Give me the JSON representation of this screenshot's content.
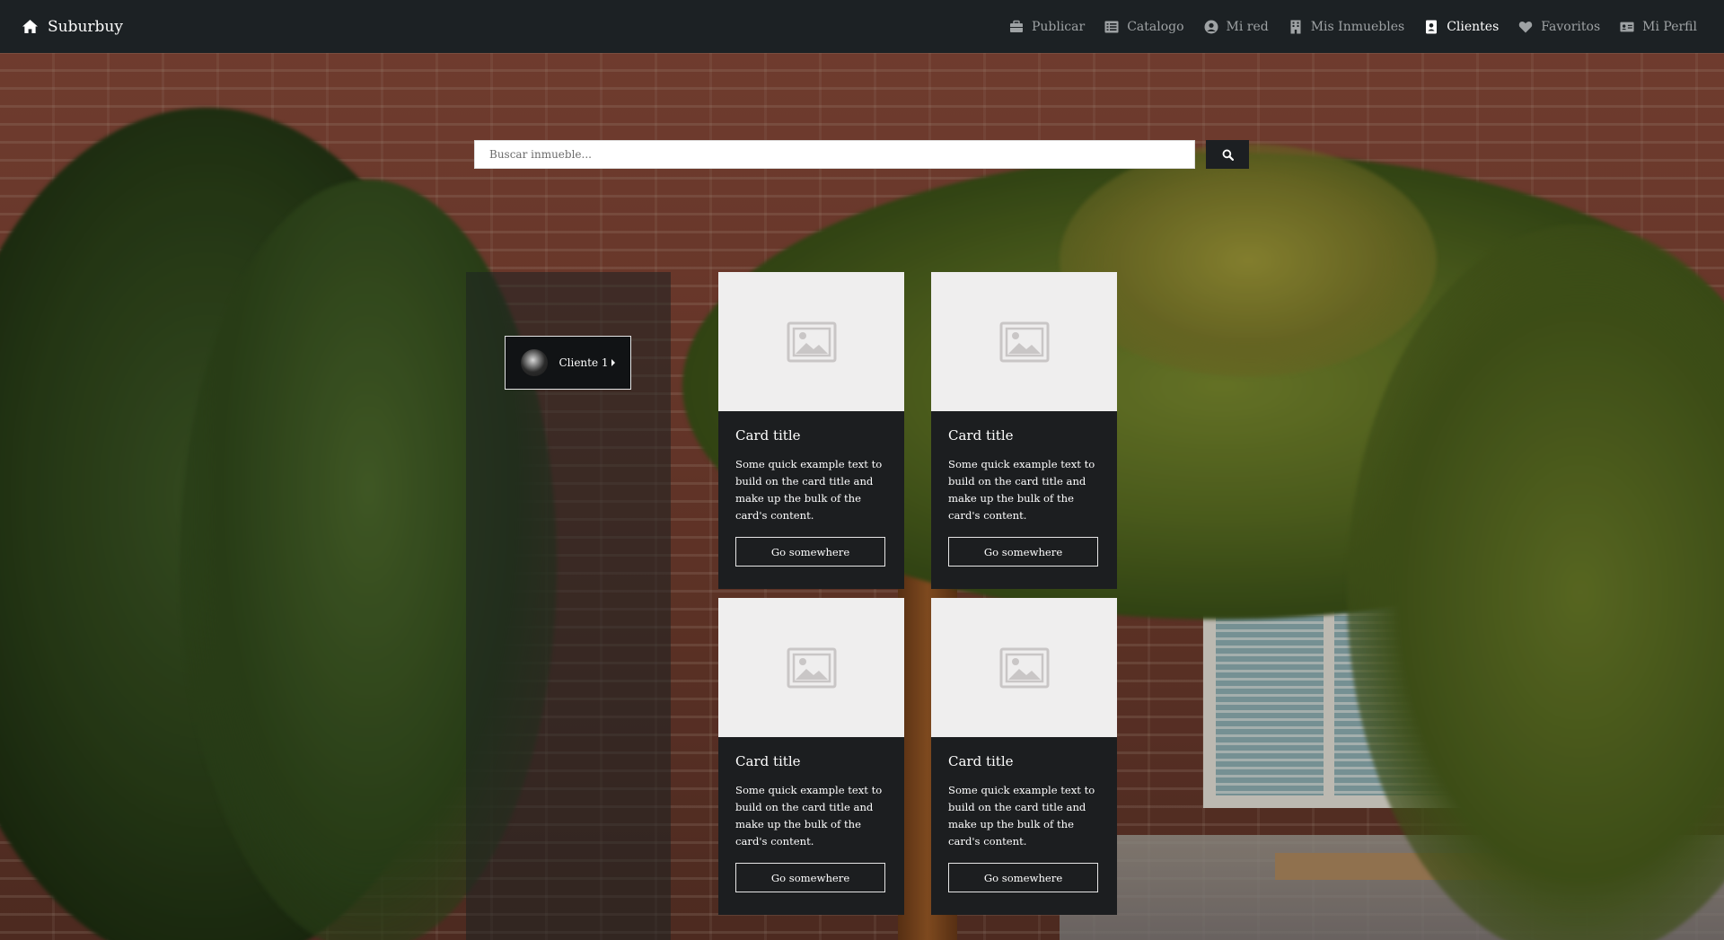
{
  "navbar": {
    "brand": "Suburbuy",
    "brand_icon": "home-icon",
    "items": [
      {
        "label": "Publicar",
        "icon": "briefcase-icon",
        "active": false
      },
      {
        "label": "Catalogo",
        "icon": "list-icon",
        "active": false
      },
      {
        "label": "Mi red",
        "icon": "user-circle-icon",
        "active": false
      },
      {
        "label": "Mis Inmuebles",
        "icon": "building-icon",
        "active": false
      },
      {
        "label": "Clientes",
        "icon": "contact-book-icon",
        "active": true
      },
      {
        "label": "Favoritos",
        "icon": "heart-icon",
        "active": false
      },
      {
        "label": "Mi Perfil",
        "icon": "id-card-icon",
        "active": false
      }
    ]
  },
  "search": {
    "placeholder": "Buscar inmueble...",
    "value": "",
    "button_icon": "search-icon"
  },
  "sidebar": {
    "client_button": {
      "label": "Cliente 1",
      "icon": "caret-right-icon"
    }
  },
  "cards": [
    {
      "title": "Card title",
      "text": "Some quick example text to build on the card title and make up the bulk of the card's content.",
      "button": "Go somewhere",
      "image_icon": "image-placeholder-icon"
    },
    {
      "title": "Card title",
      "text": "Some quick example text to build on the card title and make up the bulk of the card's content.",
      "button": "Go somewhere",
      "image_icon": "image-placeholder-icon"
    },
    {
      "title": "Card title",
      "text": "Some quick example text to build on the card title and make up the bulk of the card's content.",
      "button": "Go somewhere",
      "image_icon": "image-placeholder-icon"
    },
    {
      "title": "Card title",
      "text": "Some quick example text to build on the card title and make up the bulk of the card's content.",
      "button": "Go somewhere",
      "image_icon": "image-placeholder-icon"
    }
  ],
  "colors": {
    "navbar_bg": "#1c2124",
    "nav_text": "#9ea2a4",
    "nav_active": "#ffffff",
    "card_bg": "#1c1e20",
    "image_placeholder_bg": "#efeeee"
  }
}
